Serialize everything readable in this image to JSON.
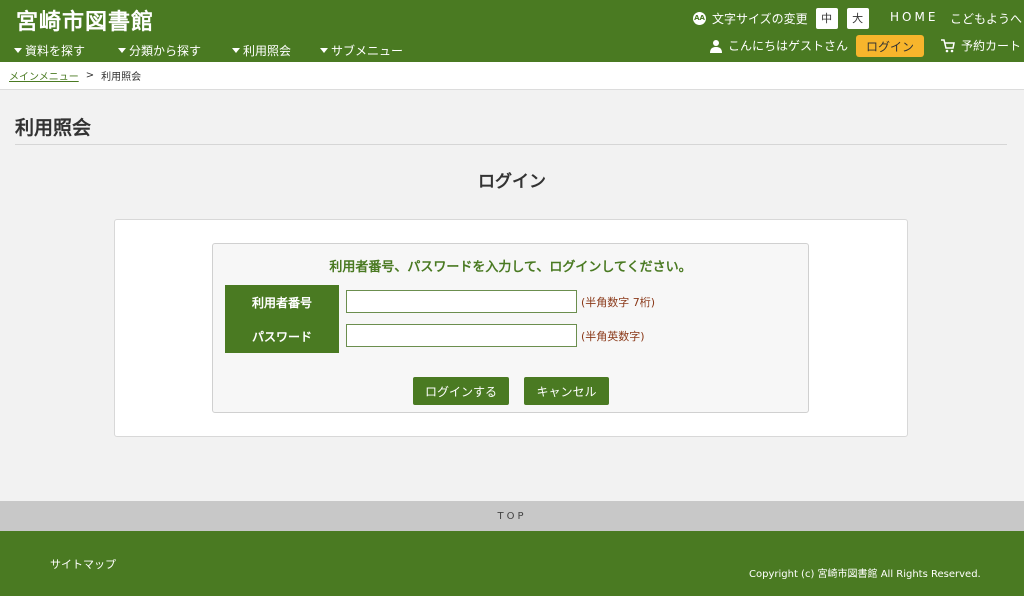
{
  "header": {
    "site_title": "宮崎市図書館",
    "font_size_label": "文字サイズの変更",
    "font_size_icon": "font-size-icon",
    "font_size_icon_text": "AA",
    "font_size_medium": "中",
    "font_size_large": "大",
    "home_link": "HOME",
    "kids_link": "こどもようへ",
    "greeting": "こんにちはゲストさん",
    "login_button": "ログイン",
    "cart_link": "予約カート"
  },
  "nav": {
    "items": [
      {
        "label": "資料を探す"
      },
      {
        "label": "分類から探す"
      },
      {
        "label": "利用照会"
      },
      {
        "label": "サブメニュー"
      }
    ]
  },
  "breadcrumb": {
    "home": "メインメニュー",
    "separator": ">",
    "current": "利用照会"
  },
  "main": {
    "page_title": "利用照会",
    "section_title": "ログイン",
    "instruction": "利用者番号、パスワードを入力して、ログインしてください。",
    "fields": [
      {
        "label": "利用者番号",
        "value": "",
        "hint": "(半角数字 7桁)"
      },
      {
        "label": "パスワード",
        "value": "",
        "hint": "(半角英数字)"
      }
    ],
    "submit_button": "ログインする",
    "cancel_button": "キャンセル"
  },
  "footer": {
    "top_link": "TOP",
    "sitemap": "サイトマップ",
    "copyright": "Copyright (c) 宮崎市図書館 All Rights Reserved."
  },
  "colors": {
    "brand_green": "#4a7a22",
    "login_orange": "#f7b52c",
    "hint_brown": "#8b3a1a"
  }
}
